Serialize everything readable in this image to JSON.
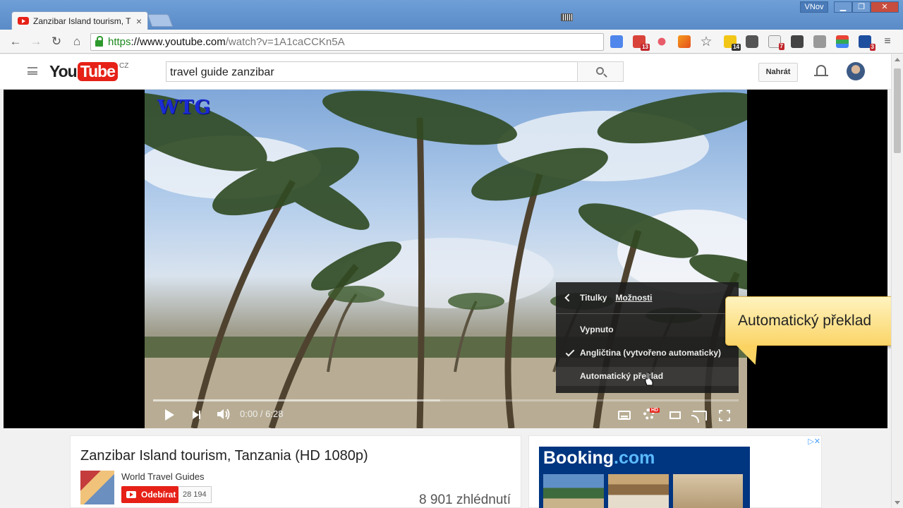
{
  "browser": {
    "tab_title": "Zanzibar Island tourism, T",
    "tab_close": "×",
    "user_badge": "VNov",
    "window_min": "▁",
    "window_max": "❐",
    "window_close": "✕",
    "url_scheme": "https",
    "url_host": "://www.youtube.com",
    "url_path": "/watch?v=1A1caCCKn5A",
    "ext_badges": [
      "13",
      "14",
      "7",
      "3"
    ]
  },
  "youtube": {
    "logo_you": "You",
    "logo_tube": "Tube",
    "logo_country": "CZ",
    "search_query": "travel guide zanzibar",
    "upload_label": "Nahrát"
  },
  "player": {
    "watermark": "WTG",
    "time": "0:00 / 6:28",
    "loaded_fraction": 0.49,
    "hd_badge": "HD",
    "menu": {
      "header_label": "Titulky",
      "options_label": "Možnosti",
      "items": [
        "Vypnuto",
        "Angličtina (vytvořeno automaticky)",
        "Automatický překlad"
      ],
      "selected_index": 1,
      "hovered_index": 2
    }
  },
  "callout": {
    "text": "Automatický překlad"
  },
  "video_info": {
    "title": "Zanzibar Island tourism, Tanzania (HD 1080p)",
    "channel": "World Travel Guides",
    "subscribe_label": "Odebírat",
    "subscriber_count": "28 194",
    "views": "8 901 zhlédnutí"
  },
  "ad": {
    "brand_main": "Booking",
    "brand_suffix": ".com",
    "adchoices": "▷✕"
  },
  "colors": {
    "youtube_red": "#e62117",
    "booking_blue": "#003580",
    "callout_yellow": "#fbd568"
  }
}
